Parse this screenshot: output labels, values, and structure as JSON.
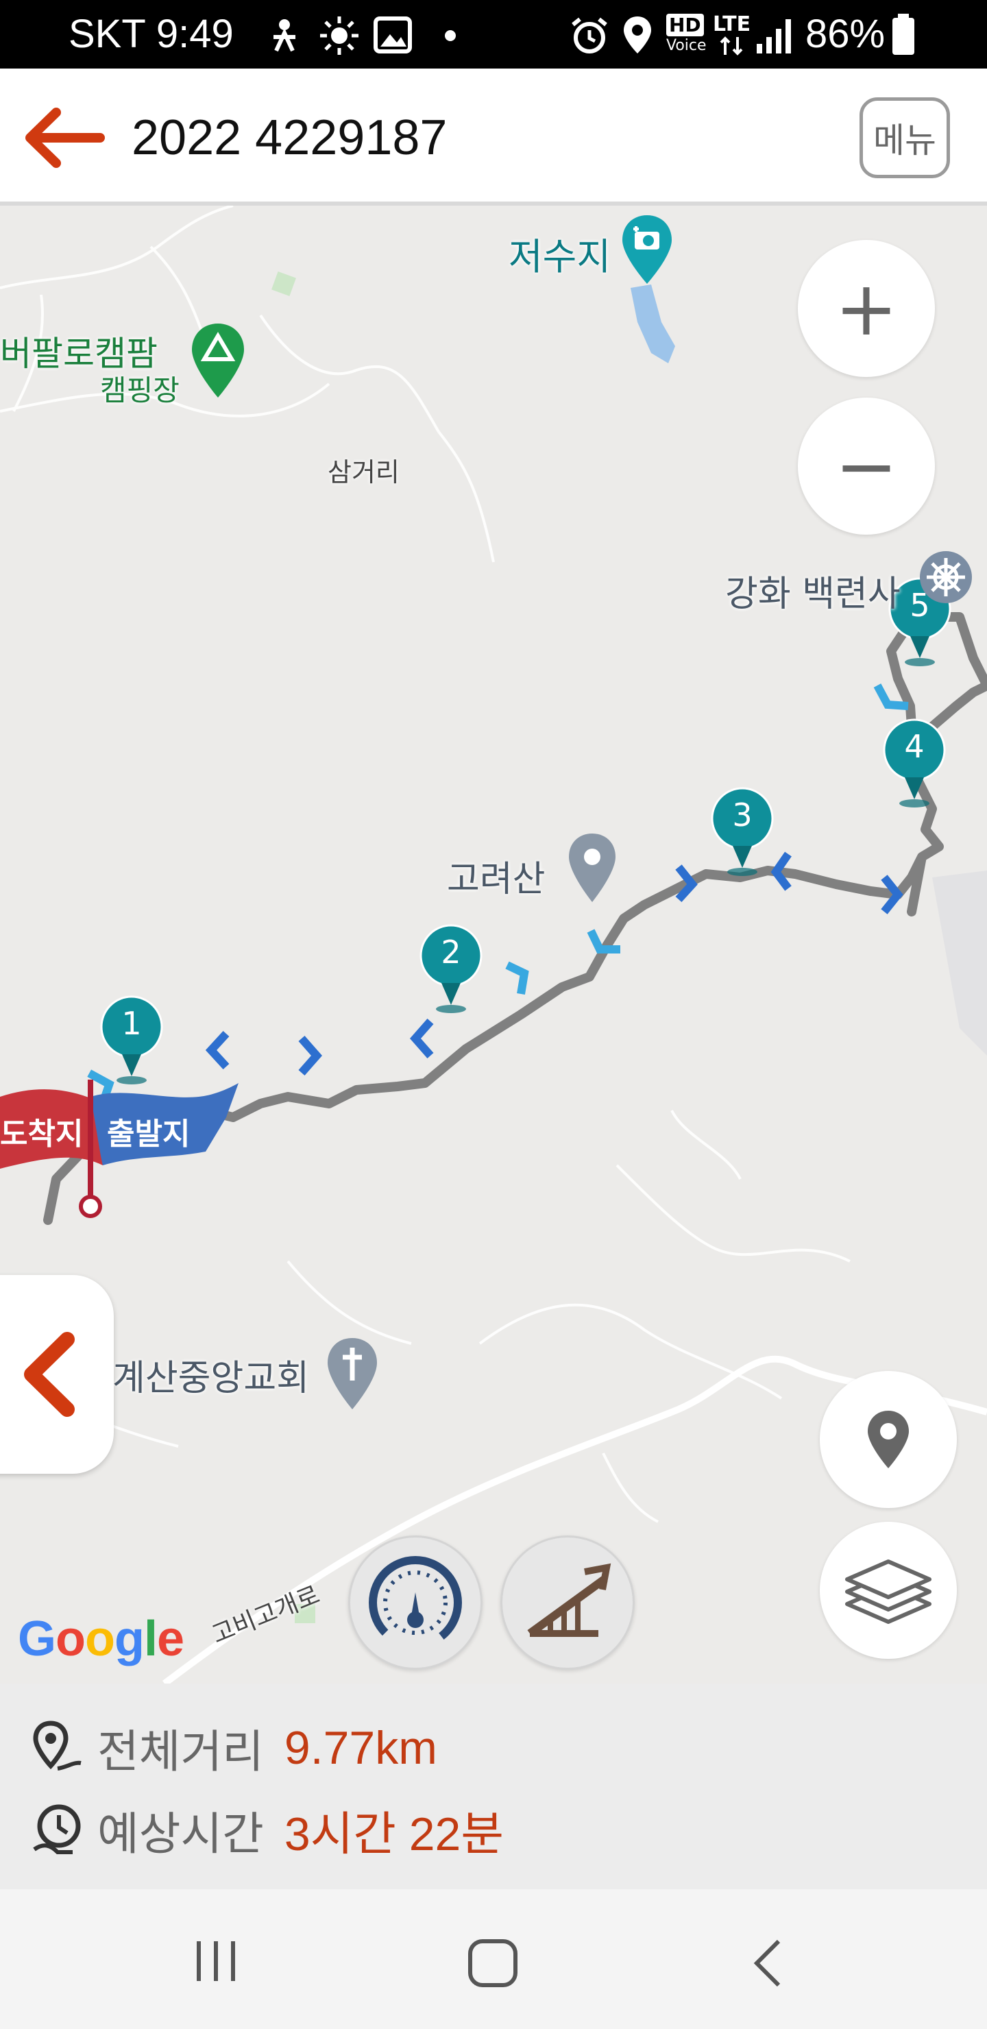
{
  "status_bar": {
    "carrier_time": "SKT 9:49",
    "battery": "86%",
    "network": "LTE",
    "hd_voice": "HD",
    "voice_label": "Voice"
  },
  "header": {
    "title": "2022 4229187",
    "menu_label": "메뉴",
    "accent_color": "#d03a10"
  },
  "map": {
    "labels": {
      "reservoir": "저수지",
      "campground_name": "버팔로캠팜",
      "campground_type": "캠핑장",
      "samgeori": "삼거리",
      "temple": "강화 백련사",
      "goryeosan": "고려산",
      "church": "계산중앙교회",
      "road": "고비고개로"
    },
    "waypoints": [
      "1",
      "2",
      "3",
      "4",
      "5"
    ],
    "flags": {
      "start": "출발지",
      "end": "도착지"
    },
    "zoom_in": "+",
    "zoom_out": "−",
    "google_logo": {
      "G": "G",
      "o1": "o",
      "o2": "o",
      "g": "g",
      "l": "l",
      "e": "e"
    },
    "waypoint_color": "#0f8f9a",
    "route_color": "#808080"
  },
  "info": {
    "distance_label": "전체거리",
    "distance_value": "9.77km",
    "time_label": "예상시간",
    "time_value": "3시간 22분"
  }
}
